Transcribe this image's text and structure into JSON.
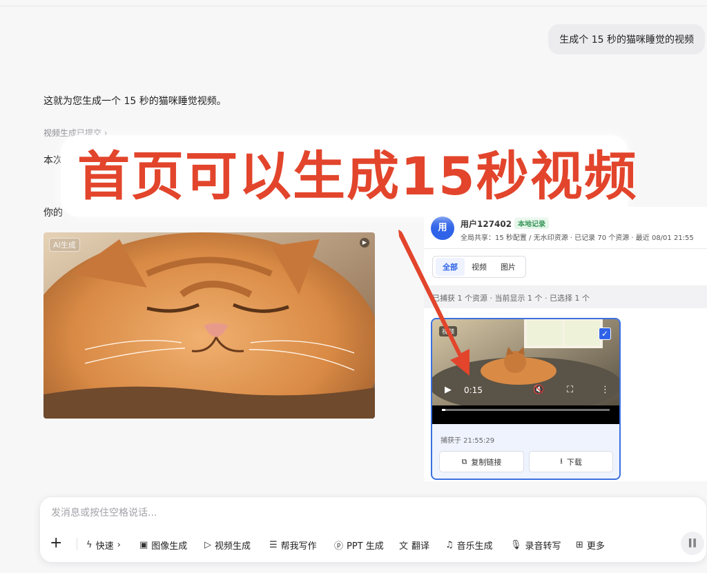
{
  "user_message": "生成个 15 秒的猫咪睡觉的视频",
  "reply": {
    "line1": "这就为您生成一个 15 秒的猫咪睡觉视频。",
    "status": "视频生成已提交 ›",
    "line2_start": "本次",
    "line2_end": "。",
    "line3_start": "你的"
  },
  "video": {
    "badge": "AI生成"
  },
  "overlay_banner": "首页可以生成15秒视频",
  "panel": {
    "avatar": "用",
    "user_name": "用户127402",
    "badge": "本地记录",
    "meta": "全局共享：15 秒配置 / 无水印资源 · 已记录 70 个资源 · 最近 08/01 21:55",
    "tabs": [
      "全部",
      "视频",
      "图片"
    ],
    "active_tab": "全部",
    "filter_text": "已捕获 1 个资源 · 当前显示 1 个 · 已选择 1 个",
    "card": {
      "tag": "视频",
      "time": "0:15",
      "progress": 0.02,
      "captured": "捕获于 21:55:29",
      "copy_label": "复制链接",
      "download_label": "下载"
    }
  },
  "composer": {
    "placeholder": "发消息或按住空格说话...",
    "tools": [
      {
        "label": "快速",
        "icon": "bolt-icon"
      },
      {
        "label": "图像生成",
        "icon": "image-icon"
      },
      {
        "label": "视频生成",
        "icon": "video-icon"
      },
      {
        "label": "帮我写作",
        "icon": "write-icon"
      },
      {
        "label": "PPT 生成",
        "icon": "ppt-icon"
      },
      {
        "label": "翻译",
        "icon": "translate-icon"
      },
      {
        "label": "音乐生成",
        "icon": "music-icon"
      },
      {
        "label": "录音转写",
        "icon": "microphone-icon"
      },
      {
        "label": "更多",
        "icon": "grid-icon"
      }
    ]
  },
  "colors": {
    "accent": "#2f63e8",
    "banner_text": "#e2452c",
    "arrow": "#e2452c"
  }
}
